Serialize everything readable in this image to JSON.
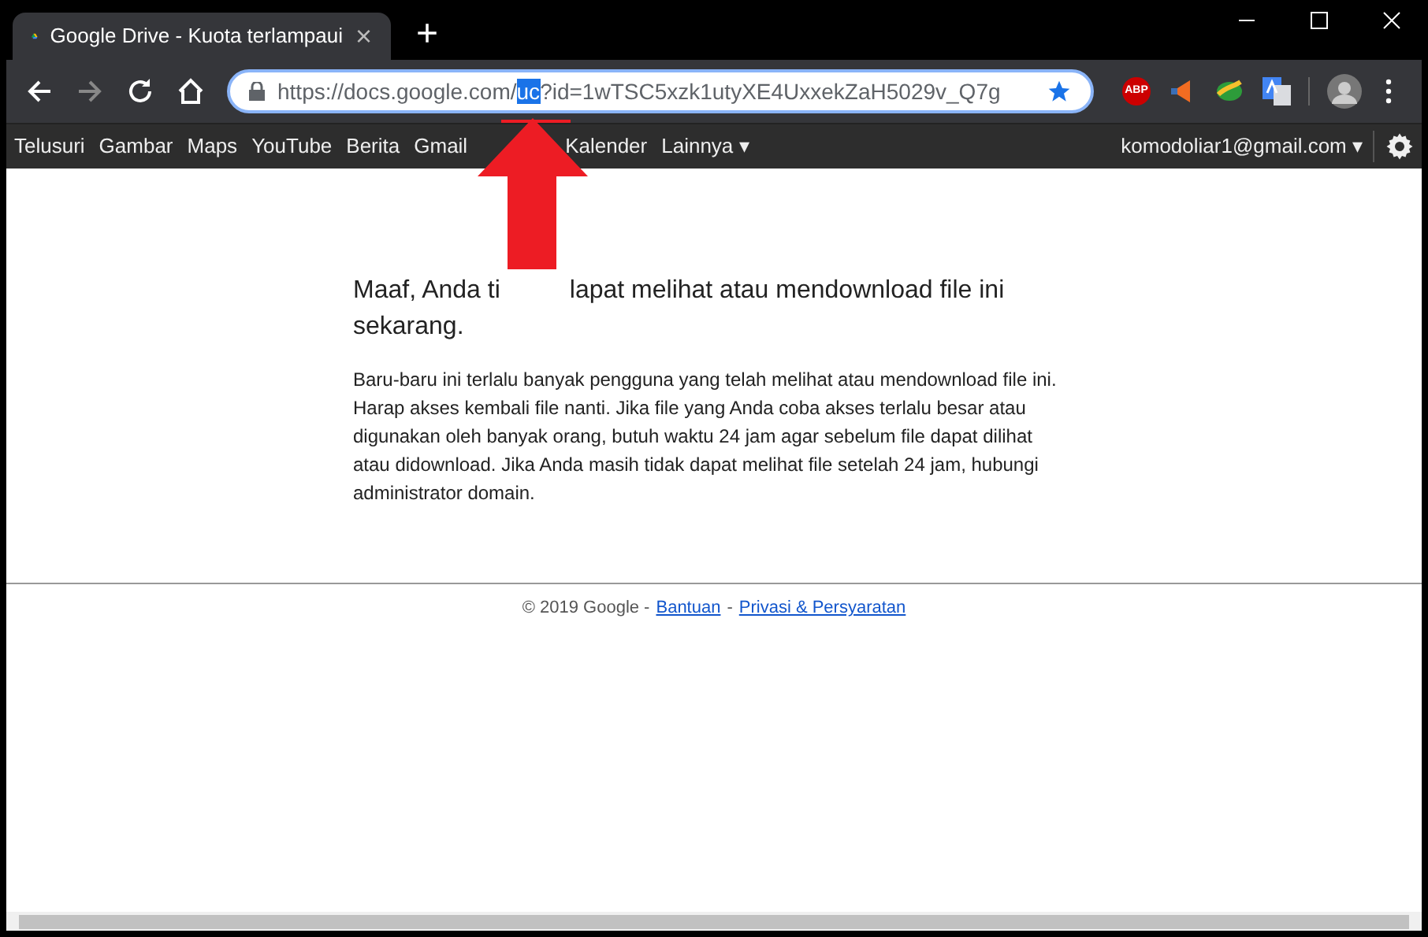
{
  "tab": {
    "title": "Google Drive - Kuota terlampaui",
    "close": "×",
    "new_tab": "+"
  },
  "address_bar": {
    "prefix": "https://docs.google.com/",
    "selected": "uc",
    "suffix": "?id=1wTSC5xzk1utyXE4UxxekZaH5029v_Q7g"
  },
  "extensions": [
    {
      "label": "ABP"
    }
  ],
  "google_bar": {
    "links": [
      {
        "label": "Telusuri"
      },
      {
        "label": "Gambar"
      },
      {
        "label": "Maps"
      },
      {
        "label": "YouTube"
      },
      {
        "label": "Berita"
      },
      {
        "label": "Gmail"
      },
      {
        "kind": "covered"
      },
      {
        "label": "Kalender"
      },
      {
        "label": "Lainnya ▾"
      }
    ],
    "account": "komodoliar1@gmail.com ▾"
  },
  "message": {
    "heading_before": "Maaf, Anda ti",
    "heading_after": "lapat melihat atau mendownload file ini sekarang.",
    "body": "Baru-baru ini terlalu banyak pengguna yang telah melihat atau mendownload file ini. Harap akses kembali file nanti. Jika file yang Anda coba akses terlalu besar atau digunakan oleh banyak orang, butuh waktu 24 jam agar sebelum file dapat dilihat atau didownload. Jika Anda masih tidak dapat melihat file setelah 24 jam, hubungi administrator domain."
  },
  "footer": {
    "copyright": "© 2019 Google -",
    "links": [
      {
        "label": "Bantuan"
      },
      {
        "label": "Privasi & Persyaratan"
      }
    ],
    "separator": "-"
  }
}
